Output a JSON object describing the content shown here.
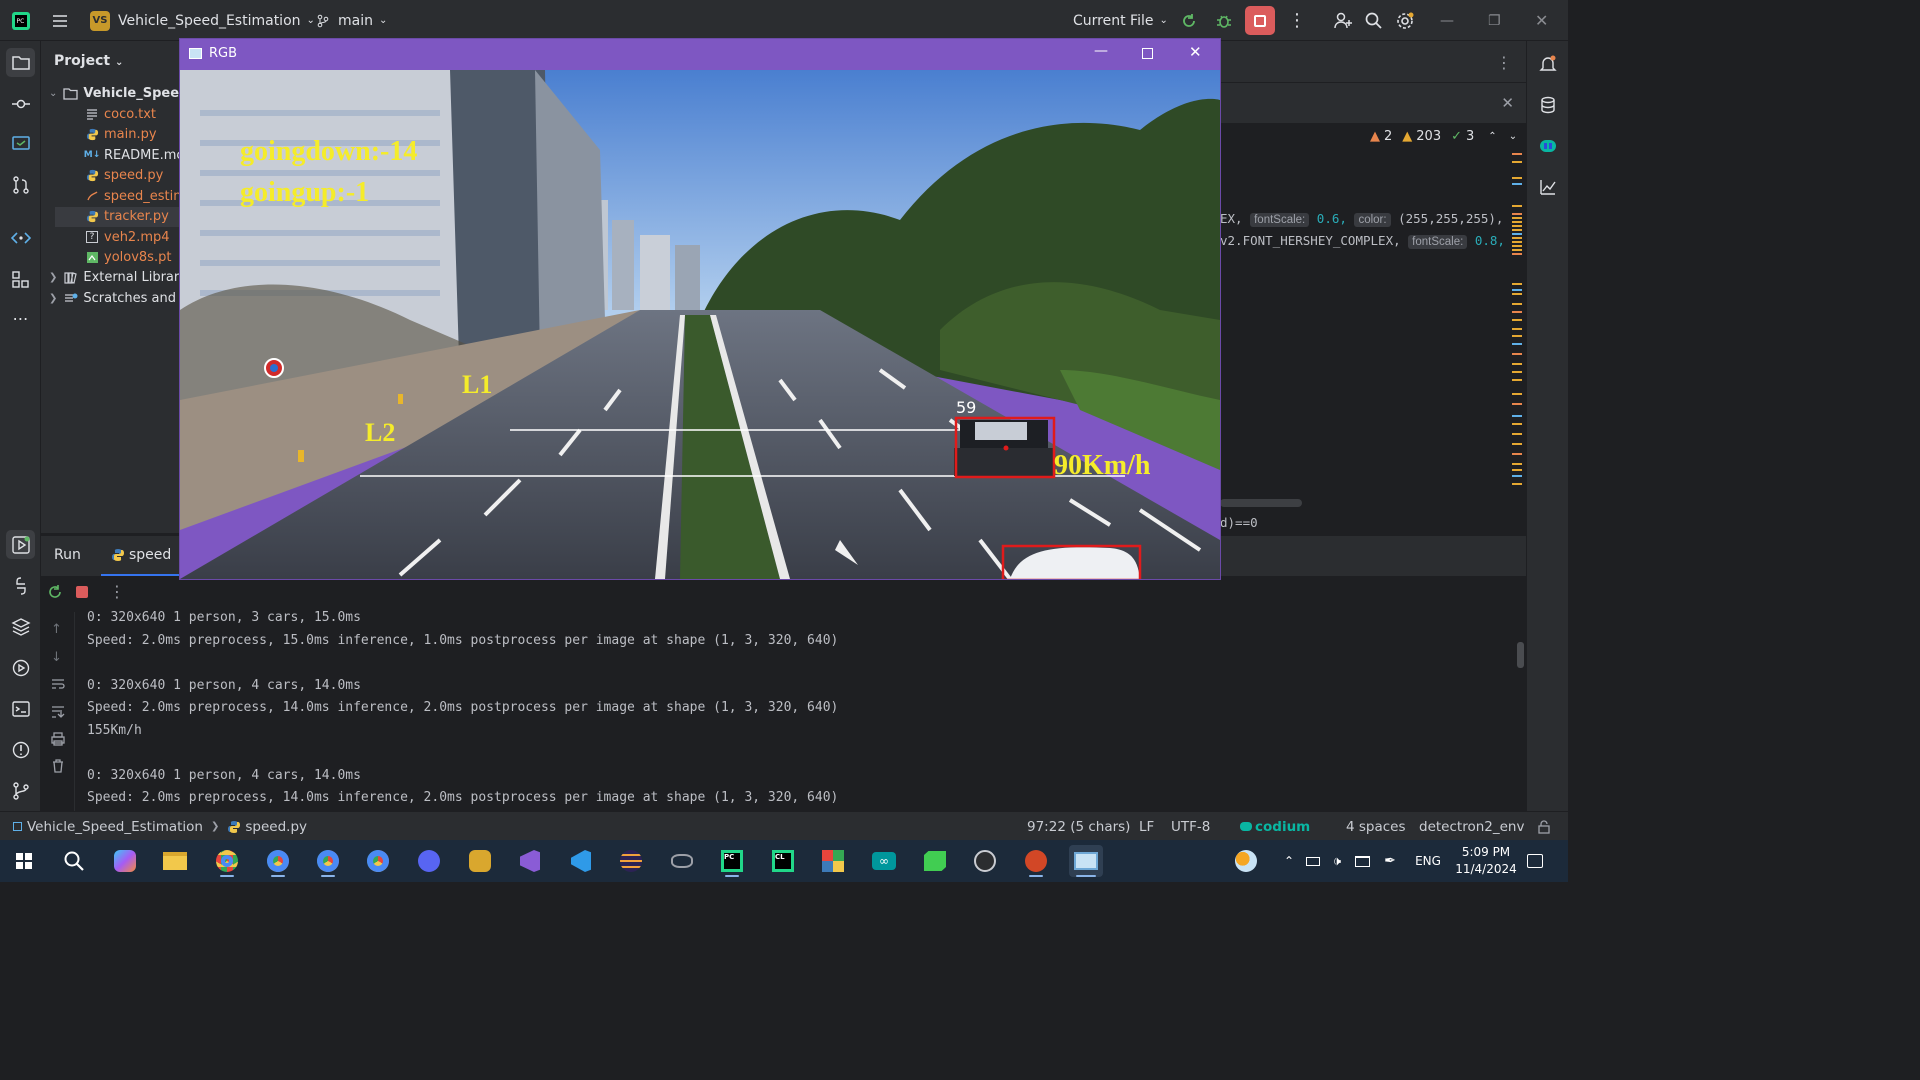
{
  "topbar": {
    "project_badge": "VS",
    "project_name": "Vehicle_Speed_Estimation",
    "branch": "main",
    "run_config": "Current File"
  },
  "project_panel": {
    "title": "Project",
    "root": "Vehicle_Spee",
    "files": [
      {
        "name": "coco.txt",
        "color": "#e8854d",
        "icon": "text-file-icon"
      },
      {
        "name": "main.py",
        "color": "#e8854d",
        "icon": "python-file-icon"
      },
      {
        "name": "README.mc",
        "color": "#dfe1e5",
        "icon": "markdown-file-icon"
      },
      {
        "name": "speed.py",
        "color": "#e8854d",
        "icon": "python-file-icon"
      },
      {
        "name": "speed_estin",
        "color": "#e8854d",
        "icon": "file-icon"
      },
      {
        "name": "tracker.py",
        "color": "#e8854d",
        "icon": "python-file-icon"
      },
      {
        "name": "veh2.mp4",
        "color": "#e8854d",
        "icon": "unknown-file-icon"
      },
      {
        "name": "yolov8s.pt",
        "color": "#e8854d",
        "icon": "binary-file-icon"
      }
    ],
    "external": "External Librar",
    "scratches": "Scratches and"
  },
  "editor": {
    "warnings": "2",
    "weak_warnings": "203",
    "ok": "3",
    "line1_pre": "EX,",
    "hint_fontscale": "fontScale:",
    "line1_scale": "0.6,",
    "hint_color": "color:",
    "line1_color": "(255,255,255),",
    "line2_pre": "v2.FONT_HERSHEY_COMPLEX,",
    "line2_scale": "0.8,",
    "line3": "d)==0"
  },
  "rgb_window": {
    "title": "RGB",
    "going_down": "goingdown:-14",
    "going_up": "goingup:-1",
    "line1_label": "L1",
    "line2_label": "L2",
    "car_id": "59",
    "car_speed": "90Km/h"
  },
  "run_panel": {
    "tab_run": "Run",
    "tab_config": "speed",
    "output": [
      "0: 320x640 1 person, 3 cars, 15.0ms",
      "Speed: 2.0ms preprocess, 15.0ms inference, 1.0ms postprocess per image at shape (1, 3, 320, 640)",
      "",
      "0: 320x640 1 person, 4 cars, 14.0ms",
      "Speed: 2.0ms preprocess, 14.0ms inference, 2.0ms postprocess per image at shape (1, 3, 320, 640)",
      "155Km/h",
      "",
      "0: 320x640 1 person, 4 cars, 14.0ms",
      "Speed: 2.0ms preprocess, 14.0ms inference, 2.0ms postprocess per image at shape (1, 3, 320, 640)"
    ]
  },
  "statusbar": {
    "crumb_project": "Vehicle_Speed_Estimation",
    "crumb_file": "speed.py",
    "position": "97:22 (5 chars)",
    "line_sep": "LF",
    "encoding": "UTF-8",
    "plugin": "codium",
    "indent": "4 spaces",
    "interpreter": "detectron2_env"
  },
  "taskbar": {
    "lang": "ENG",
    "time": "5:09 PM",
    "date": "11/4/2024"
  },
  "colors": {
    "accent": "#3574f0",
    "stop": "#db5c5c",
    "dialog": "#7e57c2",
    "overlay_text": "#f5ec2a",
    "box": "#e01b1b"
  }
}
